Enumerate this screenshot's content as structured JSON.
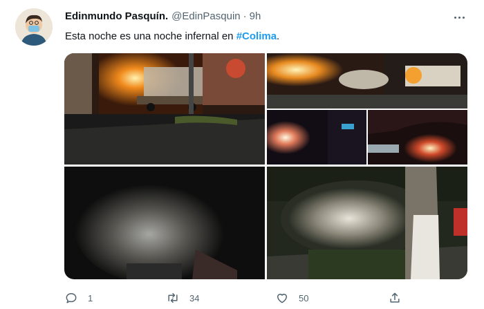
{
  "tweet": {
    "author_name": "Edinmundo Pasquín.",
    "handle": "@EdinPasquin",
    "separator": "·",
    "time": "9h",
    "text_prefix": "Esta noche es una noche infernal en ",
    "hashtag": "#Colima",
    "text_suffix": "."
  },
  "actions": {
    "reply_count": "1",
    "retweet_count": "34",
    "like_count": "50"
  },
  "media": {
    "images": [
      {
        "description_icon": "photo",
        "alt": "burning-truck"
      },
      {
        "description_icon": "photo",
        "alt": "burning-cars-street"
      },
      {
        "description_icon": "photo",
        "alt": "night-fire-explosion"
      },
      {
        "description_icon": "photo",
        "alt": "fire-under-trees"
      },
      {
        "description_icon": "photo",
        "alt": "smoke-at-night"
      },
      {
        "description_icon": "photo",
        "alt": "smoke-by-tree"
      }
    ]
  },
  "colors": {
    "hashtag": "#1d9bf0",
    "muted": "#536471",
    "text": "#0f1419"
  }
}
